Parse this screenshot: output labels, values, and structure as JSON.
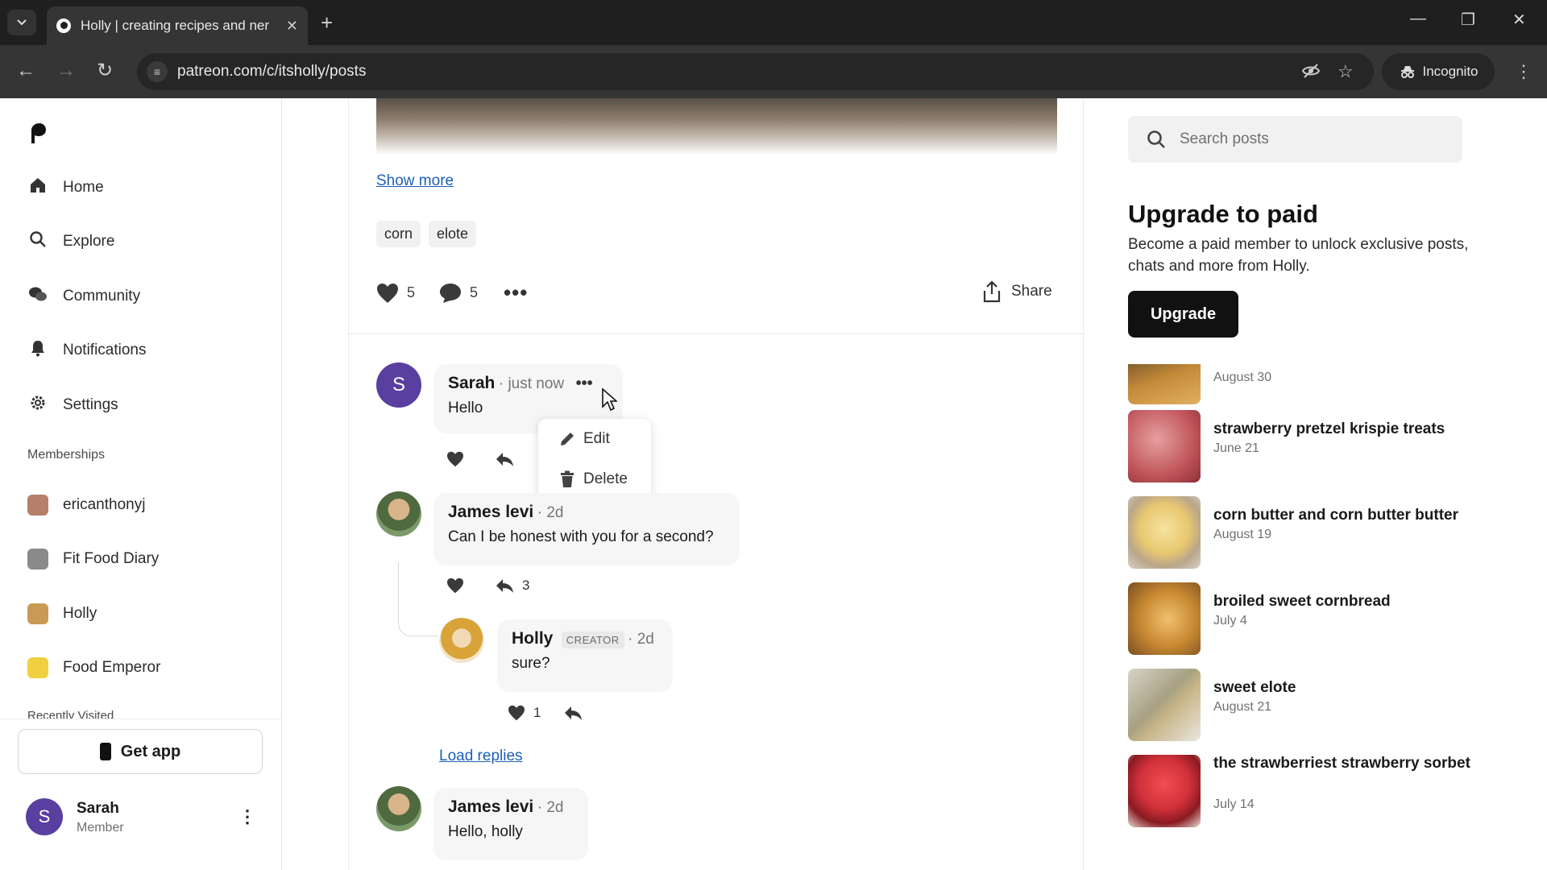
{
  "browser": {
    "tab_title": "Holly | creating recipes and ner",
    "url": "patreon.com/c/itsholly/posts",
    "incognito_label": "Incognito"
  },
  "sidebar": {
    "nav": [
      {
        "label": "Home",
        "icon": "home-icon"
      },
      {
        "label": "Explore",
        "icon": "search-icon"
      },
      {
        "label": "Community",
        "icon": "chat-icon"
      },
      {
        "label": "Notifications",
        "icon": "bell-icon"
      },
      {
        "label": "Settings",
        "icon": "gear-icon"
      }
    ],
    "memberships_label": "Memberships",
    "memberships": [
      {
        "label": "ericanthonyj",
        "color": "#b5806a"
      },
      {
        "label": "Fit Food Diary",
        "color": "#8a8a8a"
      },
      {
        "label": "Holly",
        "color": "#c99a55"
      },
      {
        "label": "Food Emperor",
        "color": "#f0d040"
      }
    ],
    "recently_visited_label": "Recently Visited",
    "get_app_label": "Get app",
    "user": {
      "initial": "S",
      "name": "Sarah",
      "role": "Member"
    }
  },
  "post": {
    "show_more": "Show more",
    "tags": [
      "corn",
      "elote"
    ],
    "likes": "5",
    "comments": "5",
    "share_label": "Share"
  },
  "comments": [
    {
      "initial": "S",
      "name": "Sarah",
      "time": "just now",
      "text": "Hello"
    },
    {
      "name": "James levi",
      "time": "2d",
      "text": "Can I be honest with you for a second?",
      "reply_count": "3"
    },
    {
      "name": "Holly",
      "badge": "CREATOR",
      "time": "2d",
      "text": "sure?",
      "likes": "1"
    },
    {
      "name": "James levi",
      "time": "2d",
      "text": "Hello, holly"
    }
  ],
  "comment_menu": {
    "edit": "Edit",
    "delete": "Delete"
  },
  "load_replies": "Load replies",
  "rail": {
    "search_placeholder": "Search posts",
    "upgrade_title": "Upgrade to paid",
    "upgrade_desc": "Become a paid member to unlock exclusive posts, chats and more from Holly.",
    "upgrade_button": "Upgrade",
    "recent_posts": [
      {
        "title": "",
        "date": "August 30",
        "color": "#c48a3a"
      },
      {
        "title": "strawberry pretzel krispie treats",
        "date": "June 21",
        "color": "#c0555a"
      },
      {
        "title": "corn butter and corn butter butter",
        "date": "August 19",
        "color": "#e8c870"
      },
      {
        "title": "broiled sweet cornbread",
        "date": "July 4",
        "color": "#c98a32"
      },
      {
        "title": "sweet elote",
        "date": "August 21",
        "color": "#a7a082"
      },
      {
        "title": "the strawberriest strawberry sorbet",
        "date": "July 14",
        "color": "#d0303a"
      }
    ]
  }
}
